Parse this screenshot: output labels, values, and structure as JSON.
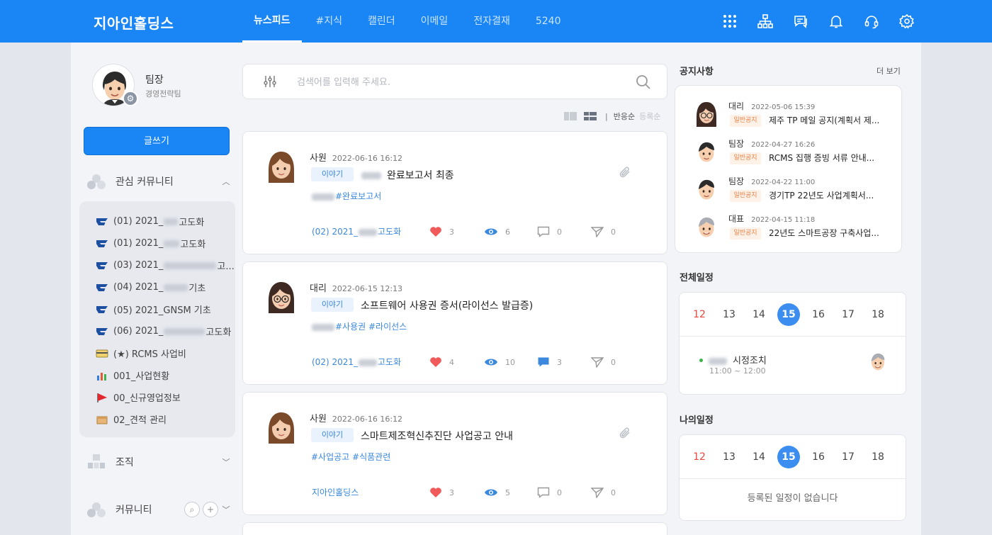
{
  "header": {
    "brand": "지아인홀딩스",
    "nav": [
      {
        "label": "뉴스피드",
        "active": true
      },
      {
        "label": "#지식",
        "active": false
      },
      {
        "label": "캘린더",
        "active": false
      },
      {
        "label": "이메일",
        "active": false
      },
      {
        "label": "전자결재",
        "active": false
      },
      {
        "label": "5240",
        "active": false
      }
    ],
    "icons": [
      "apps-grid-icon",
      "org-chart-icon",
      "chat-icon",
      "bell-icon",
      "headset-icon",
      "settings-gear-icon"
    ],
    "color": "#1a86f5"
  },
  "profile": {
    "name": "팀장",
    "team": "경영전략팀"
  },
  "sidebar": {
    "write_label": "글쓰기",
    "interest_label": "관심 커뮤니티",
    "communities": [
      {
        "prefix": "(01) 2021_",
        "suffix": "고도화",
        "icon": "community-logo-icon"
      },
      {
        "prefix": "(01) 2021_",
        "suffix": "고도화",
        "icon": "community-logo-icon"
      },
      {
        "prefix": "(03) 2021_",
        "suffix": "고...",
        "icon": "community-logo-icon"
      },
      {
        "prefix": "(04) 2021_",
        "suffix": "기초",
        "icon": "community-logo-icon"
      },
      {
        "prefix": "(05) 2021_GNSM 기초",
        "suffix": "",
        "icon": "community-logo-icon"
      },
      {
        "prefix": "(06) 2021_",
        "suffix": "고도화",
        "icon": "community-logo-icon"
      },
      {
        "prefix": "(★) RCMS 사업비",
        "suffix": "",
        "icon": "card-icon"
      },
      {
        "prefix": "001_사업현황",
        "suffix": "",
        "icon": "bar-chart-icon"
      },
      {
        "prefix": "00_신규영업정보",
        "suffix": "",
        "icon": "flag-icon"
      },
      {
        "prefix": "02_견적 관리",
        "suffix": "",
        "icon": "box-icon"
      }
    ],
    "org_label": "조직",
    "community_label": "커뮤니티"
  },
  "search": {
    "placeholder": "검색어를 입력해 주세요."
  },
  "sort": {
    "reaction": "반응순",
    "registered": "등록순"
  },
  "posts": [
    {
      "author": "사원",
      "date": "2022-06-16 16:12",
      "tag": "이야기",
      "title": "완료보고서 최종",
      "hashtags": "#완료보고서",
      "community_prefix": "(02) 2021_",
      "community_suffix": "고도화",
      "likes": "3",
      "views": "6",
      "comments": "0",
      "shares": "0",
      "avatar": "female-avatar-icon"
    },
    {
      "author": "대리",
      "date": "2022-06-15 12:13",
      "tag": "이야기",
      "title": "소프트웨어 사용권 증서(라이선스 발급증)",
      "hashtags": "#사용권 #라이선스",
      "community_prefix": "(02) 2021_",
      "community_suffix": "고도화",
      "likes": "4",
      "views": "10",
      "comments": "3",
      "shares": "0",
      "avatar": "glasses-avatar-icon"
    },
    {
      "author": "사원",
      "date": "2022-06-16 16:12",
      "tag": "이야기",
      "title": "스마트제조혁신추진단 사업공고 안내",
      "hashtags": "#사업공고 #식품관련",
      "community_prefix": "지아인홀딩스",
      "community_suffix": "",
      "likes": "3",
      "views": "5",
      "comments": "0",
      "shares": "0",
      "avatar": "female-avatar-icon"
    }
  ],
  "notices": {
    "title": "공지사항",
    "more": "더 보기",
    "items": [
      {
        "who": "대리",
        "date": "2022-05-06 15:39",
        "badge": "일반공지",
        "title": "제주 TP 메일 공지(계획서 제..."
      },
      {
        "who": "팀장",
        "date": "2022-04-27 16:26",
        "badge": "일반공지",
        "title": "RCMS 집행 증빙 서류 안내..."
      },
      {
        "who": "팀장",
        "date": "2022-04-22 11:00",
        "badge": "일반공지",
        "title": "경기TP 22년도 사업계획서..."
      },
      {
        "who": "대표",
        "date": "2022-04-15 11:18",
        "badge": "일반공지",
        "title": "22년도 스마트공장 구축사업..."
      }
    ]
  },
  "all_schedule": {
    "title": "전체일정",
    "days": [
      "12",
      "13",
      "14",
      "15",
      "16",
      "17",
      "18"
    ],
    "today": "15",
    "event": {
      "title": "시정조치",
      "time": "11:00 ~ 12:00"
    }
  },
  "my_schedule": {
    "title": "나의일정",
    "days": [
      "12",
      "13",
      "14",
      "15",
      "16",
      "17",
      "18"
    ],
    "today": "15",
    "empty": "등록된 일정이 없습니다"
  }
}
